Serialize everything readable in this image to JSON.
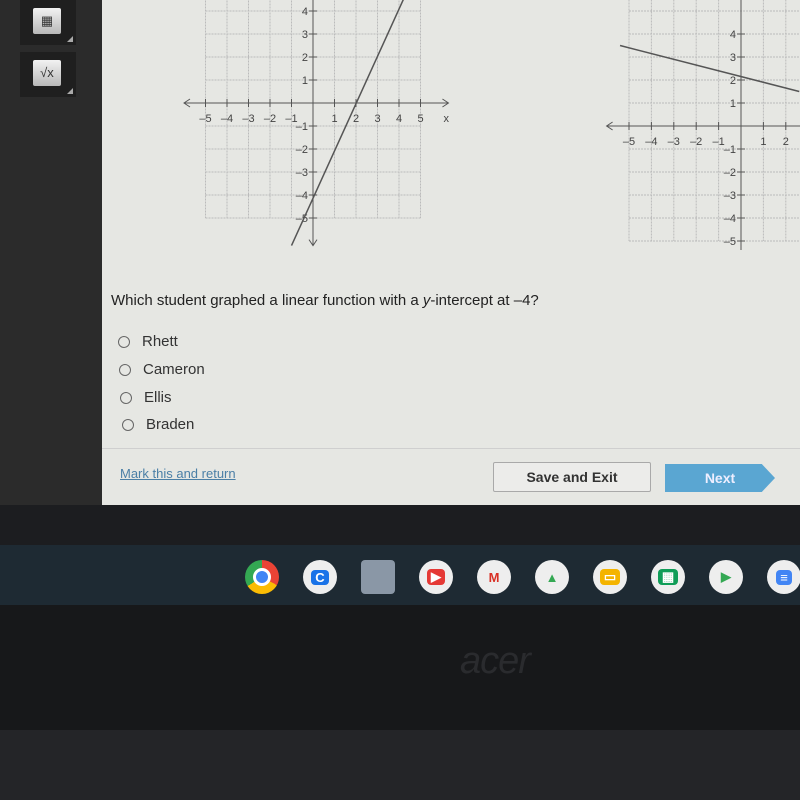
{
  "sidebar": {
    "tools": [
      {
        "icon": "calculator-icon"
      },
      {
        "icon": "square-root-icon",
        "label": "√x"
      }
    ]
  },
  "graphs": [
    {
      "xticks": [
        -5,
        -4,
        -3,
        -2,
        -1,
        1,
        2,
        3,
        4,
        5
      ],
      "yticks": [
        4,
        3,
        2,
        1,
        -1,
        -2,
        -3,
        -4,
        -5
      ],
      "x_axis_label": "x",
      "line": [
        [
          -1,
          -6.2
        ],
        [
          4.3,
          4.7
        ]
      ]
    },
    {
      "xticks": [
        -5,
        -4,
        -3,
        -2,
        -1,
        1,
        2
      ],
      "yticks": [
        4,
        3,
        2,
        1,
        -1,
        -2,
        -3,
        -4,
        -5
      ],
      "line": [
        [
          -5.4,
          3.5
        ],
        [
          2.6,
          1.5
        ]
      ]
    }
  ],
  "question": "Which student graphed a linear function with a y-intercept at –4?",
  "question_parts": {
    "before": "Which student graphed a linear function with a ",
    "var": "y",
    "after": "-intercept at –4?"
  },
  "options": [
    "Rhett",
    "Cameron",
    "Ellis",
    "Braden"
  ],
  "footer": {
    "mark": "Mark this and return",
    "save": "Save and Exit",
    "next": "Next",
    "next_color": "#5aa6d2"
  },
  "shelf": [
    {
      "icon": "chrome-icon",
      "label": ""
    },
    {
      "icon": "classroom-c-icon",
      "label": "C"
    },
    {
      "icon": "app-box-icon",
      "label": ""
    },
    {
      "icon": "youtube-icon",
      "label": "▶"
    },
    {
      "icon": "gmail-icon",
      "label": "M"
    },
    {
      "icon": "drive-icon",
      "label": "▲"
    },
    {
      "icon": "slides-icon",
      "label": "▭"
    },
    {
      "icon": "sheets-icon",
      "label": "▦"
    },
    {
      "icon": "play-store-icon",
      "label": "▶"
    },
    {
      "icon": "docs-icon",
      "label": "≡"
    }
  ],
  "laptop_logo": "acer"
}
